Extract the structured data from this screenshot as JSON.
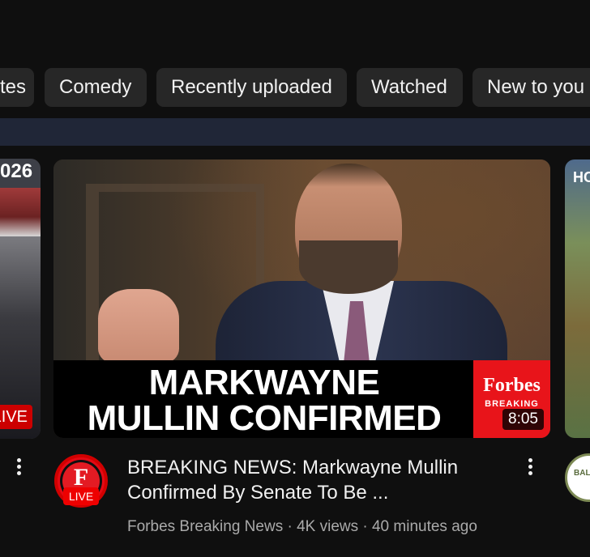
{
  "filter_chips": [
    {
      "label": "tes"
    },
    {
      "label": "Comedy"
    },
    {
      "label": "Recently uploaded"
    },
    {
      "label": "Watched"
    },
    {
      "label": "New to you"
    }
  ],
  "left_card": {
    "year_fragment": "026",
    "live_badge": "LIVE"
  },
  "main_video": {
    "thumbnail_caption_line1": "MARKWAYNE",
    "thumbnail_caption_line2": "MULLIN CONFIRMED",
    "thumbnail_brand": "Forbes",
    "thumbnail_brand_sub": "BREAKING",
    "duration": "8:05",
    "title": "BREAKING NEWS: Markwayne Mullin Confirmed By Senate To Be ...",
    "meta": "Forbes Breaking News · 4K views · 40 minutes ago",
    "channel_avatar_letter": "F",
    "channel_live_label": "LIVE"
  },
  "right_card": {
    "tag_fragment": "HC",
    "avatar_text": "BALLIS"
  },
  "icons": {
    "more": "vertical-dots-icon"
  },
  "colors": {
    "background": "#0f0f0f",
    "chip_bg": "#272727",
    "live_red": "#cc0000",
    "forbes_red": "#e8141a"
  }
}
